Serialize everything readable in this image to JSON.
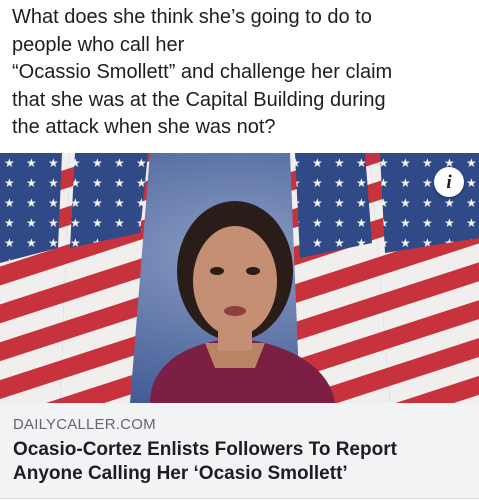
{
  "post": {
    "text": "What does she think she’s going to do to\npeople who call her\n “Ocassio Smollett” and challenge her claim\nthat she was at the Capital Building during\nthe attack when she was not?"
  },
  "link_card": {
    "info_glyph": "i",
    "domain": "DAILYCALLER.COM",
    "headline": "Ocasio-Cortez Enlists Followers To Report Anyone Calling Her ‘Ocasio Smollett’"
  },
  "icons": {
    "info": "info-icon"
  },
  "colors": {
    "text": "#1c1e21",
    "secondary_text": "#65676b",
    "card_footer": "#f2f3f5",
    "flag_red": "#c8323c",
    "flag_blue": "#2f4a86"
  }
}
